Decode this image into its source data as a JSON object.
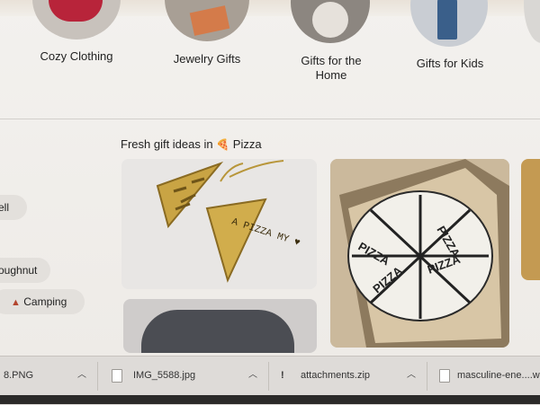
{
  "categories": [
    {
      "label": "Cozy Clothing"
    },
    {
      "label": "Jewelry Gifts"
    },
    {
      "label": "Gifts for the Home"
    },
    {
      "label": "Gifts for Kids"
    }
  ],
  "section": {
    "title_prefix": "Fresh gift ideas in ",
    "emoji": "🍕",
    "title_topic": "Pizza"
  },
  "tile_texts": {
    "pizzabox_print": "PIZZA",
    "necklace_print": "A PIZZA MY ♥"
  },
  "chips": [
    {
      "label": "ell"
    },
    {
      "label": "oughnut"
    },
    {
      "label": "Camping",
      "icon": "tent-icon"
    }
  ],
  "downloads": [
    {
      "name": "8.PNG"
    },
    {
      "name": "IMG_5588.jpg"
    },
    {
      "name": "attachments.zip"
    },
    {
      "name": "masculine-ene....web"
    }
  ],
  "icons": {
    "chevron": "chevron-up-icon"
  }
}
